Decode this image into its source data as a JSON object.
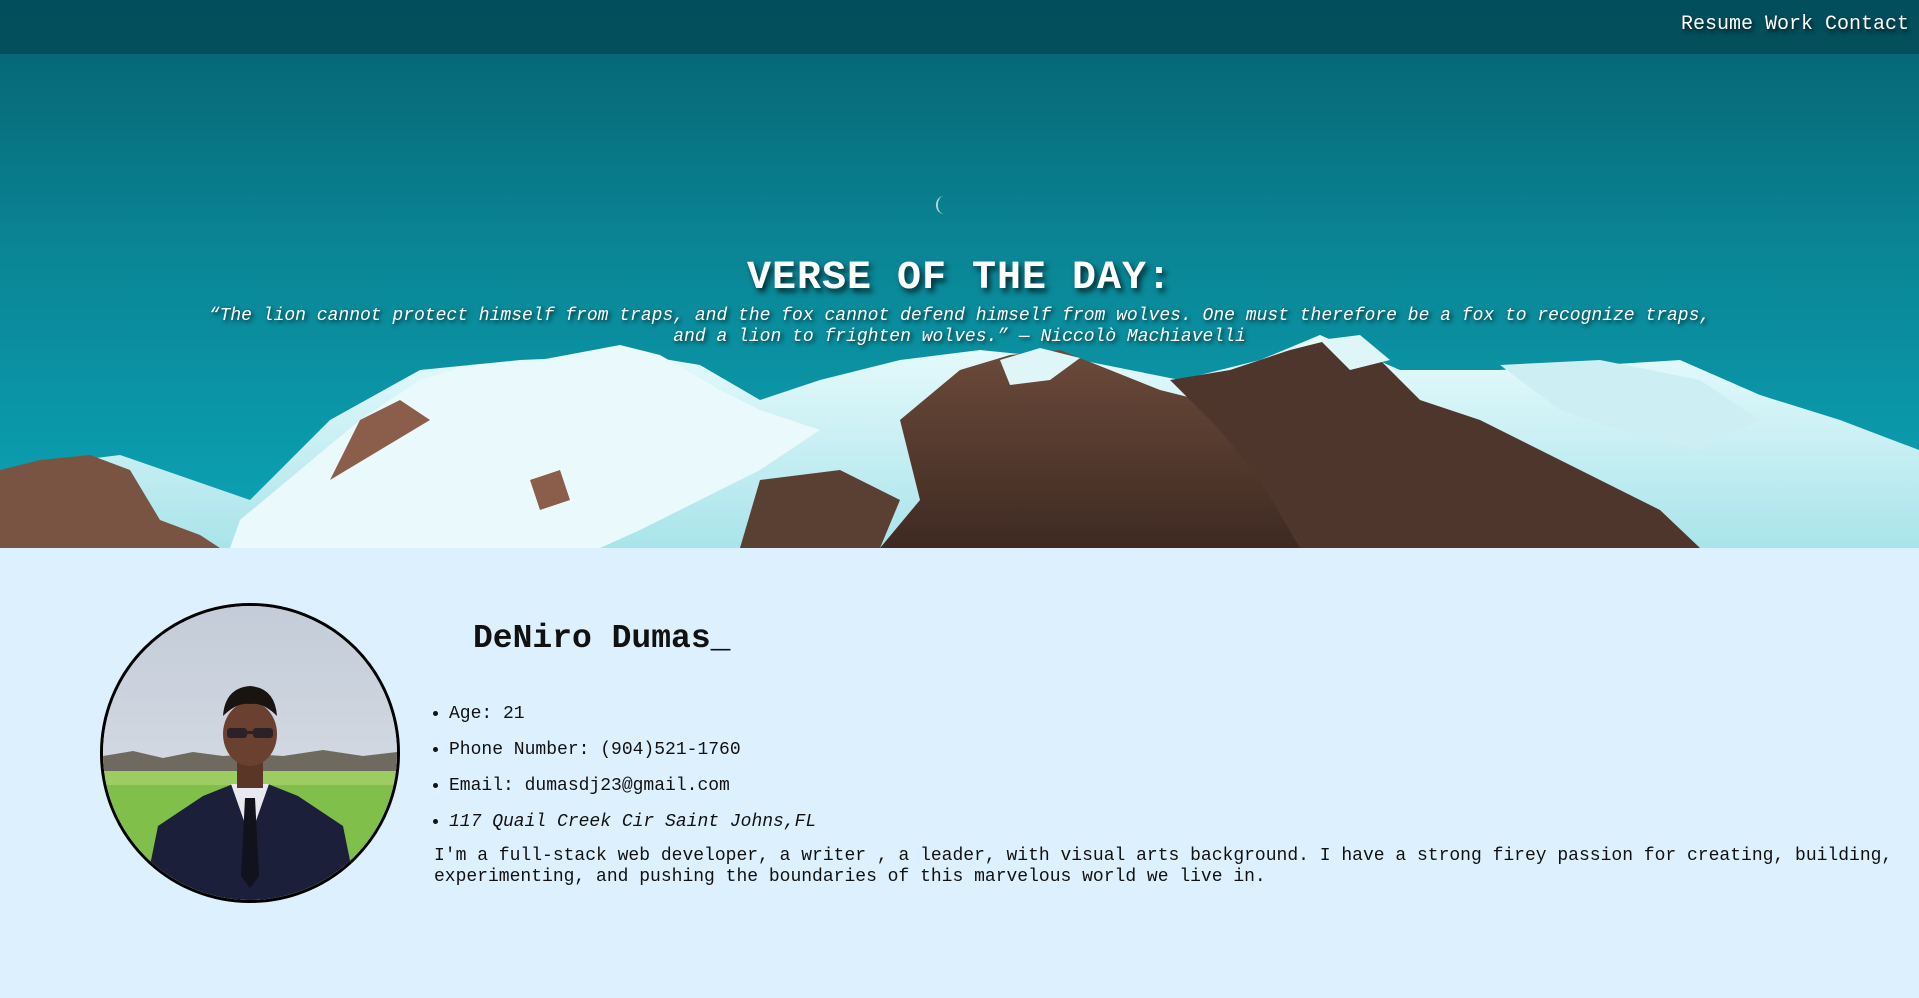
{
  "nav": {
    "items": [
      {
        "label": "Resume"
      },
      {
        "label": "Work"
      },
      {
        "label": "Contact"
      }
    ]
  },
  "hero": {
    "title": "VERSE OF THE DAY:",
    "quote_line1": "“The lion cannot protect himself from traps, and the fox cannot defend himself from wolves. One must therefore be a fox to recognize traps,",
    "quote_line2": "and a lion to frighten wolves.” — Niccolò Machiavelli",
    "background": "snowy-mountain-range-photo"
  },
  "profile": {
    "photo": "portrait-photo",
    "name": "DeNiro Dumas_",
    "details": [
      {
        "text": "Age: 21"
      },
      {
        "text": "Phone Number: (904)521-1760"
      },
      {
        "text": "Email: dumasdj23@gmail.com"
      },
      {
        "text": "117 Quail Creek Cir Saint Johns,FL"
      }
    ],
    "bio": "I'm a full-stack web developer, a writer , a leader, with visual arts background. I have a strong firey passion for creating, building, experimenting, and pushing the boundaries of this marvelous world we live in."
  },
  "colors": {
    "page_background": "#dcf0fd",
    "sky": "#0a8c9c",
    "topbar": "#034b58",
    "text": "#111111"
  }
}
